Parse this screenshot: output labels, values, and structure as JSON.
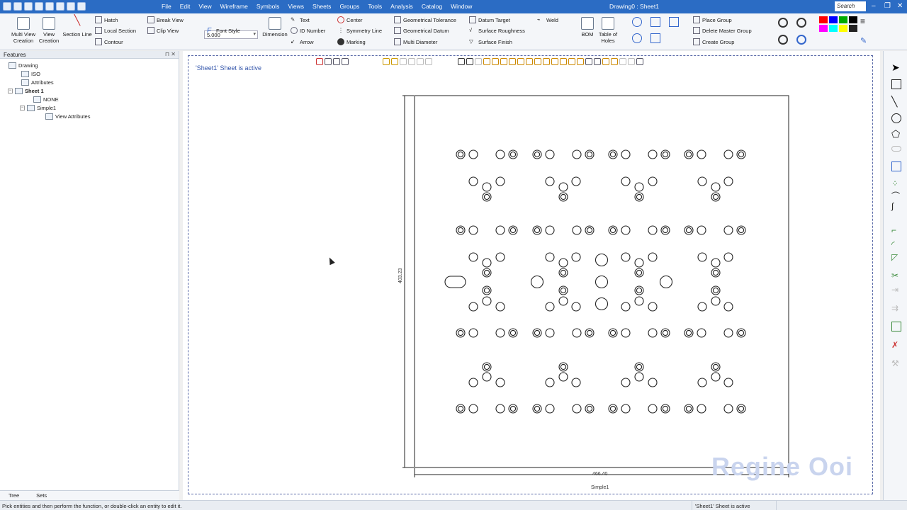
{
  "window": {
    "title": "Drawing0 : Sheet1",
    "search_placeholder": "Search",
    "menu": [
      "File",
      "Edit",
      "View",
      "Wireframe",
      "Symbols",
      "Views",
      "Sheets",
      "Groups",
      "Tools",
      "Analysis",
      "Catalog",
      "Window"
    ]
  },
  "ribbon": {
    "multi_view": "Multi View\nCreation",
    "view_creation": "View\nCreation",
    "section_line": "Section Line",
    "hatch": "Hatch",
    "local_section": "Local Section",
    "contour": "Contour",
    "break_view": "Break View",
    "clip_view": "Clip View",
    "scale_value": "5.000",
    "font_style": "Font Style",
    "dimension": "Dimension",
    "text": "Text",
    "id_number": "ID Number",
    "arrow": "Arrow",
    "center": "Center",
    "symmetry_line": "Symmetry Line",
    "marking": "Marking",
    "geom_tolerance": "Geometrical Tolerance",
    "geom_datum": "Geometrical Datum",
    "multi_diameter": "Multi Diameter",
    "datum_target": "Datum Target",
    "surface_roughness": "Surface Roughness",
    "surface_finish": "Surface Finish",
    "weld": "Weld",
    "bom": "BOM",
    "table_of_holes": "Table of\nHoles",
    "place_group": "Place Group",
    "delete_master_group": "Delete Master Group",
    "create_group": "Create Group"
  },
  "features": {
    "title": "Features",
    "tree": [
      {
        "label": "Drawing",
        "bold": false
      },
      {
        "label": "ISO",
        "bold": false
      },
      {
        "label": "Attributes",
        "bold": false
      },
      {
        "label": "Sheet 1",
        "bold": true
      },
      {
        "label": "NONE",
        "bold": false
      },
      {
        "label": "Simple1",
        "bold": false
      },
      {
        "label": "View Attributes",
        "bold": false
      }
    ],
    "tabs": [
      "Tree",
      "Sets"
    ]
  },
  "canvas": {
    "sheet_message": "'Sheet1' Sheet is active",
    "dim_vertical": "403.23",
    "dim_horizontal": "466.40",
    "view_name": "Simple1",
    "watermark": "Regine Ooi"
  },
  "status": {
    "hint": "Pick entities and then perform the function, or double-click an entity to edit it.",
    "sheet_state": "'Sheet1' Sheet is active"
  },
  "colors": {
    "title_bar": "#2b6cc4",
    "palette": [
      "#ff0000",
      "#0000ff",
      "#00aa00",
      "#000000",
      "#ff00ff",
      "#00ffff",
      "#ffff00",
      "#222222"
    ]
  }
}
